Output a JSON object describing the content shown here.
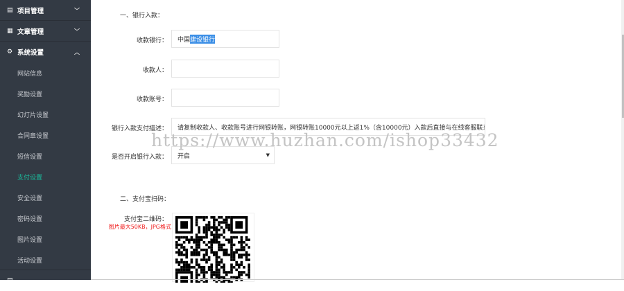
{
  "sidebar": {
    "groups": [
      {
        "label": "项目管理",
        "icon": "clipboard-icon",
        "chevron": "⌄"
      },
      {
        "label": "文章管理",
        "icon": "document-icon",
        "chevron": "⌄"
      },
      {
        "label": "系统设置",
        "icon": "gear-icon",
        "chevron": "⌃"
      }
    ],
    "sub_items": [
      "网站信息",
      "奖励设置",
      "幻灯片设置",
      "合同章设置",
      "短信设置",
      "支付设置",
      "安全设置",
      "密码设置",
      "图片设置",
      "活动设置"
    ],
    "active_index": 5,
    "active_color": "#1abc9c"
  },
  "form": {
    "section1": "一、银行入款：",
    "bank_label": "收款银行：",
    "bank_value_plain": "中国",
    "bank_value_selected": "建设银行",
    "payee_label": "收款人：",
    "payee_value": "",
    "account_label": "收款账号：",
    "account_value": "",
    "desc_label": "银行入款支付描述：",
    "desc_value": "请复制收款人、收款账号进行网银转账，网银转账10000元以上返1%（含10000元）入款后直接与在线客服联系",
    "enable_label": "是否开启银行入款：",
    "enable_value": "开启",
    "section2": "二、支付宝扫码：",
    "qr_label": "支付宝二维码：",
    "qr_hint": "图片最大50KB，JPG格式"
  },
  "watermark": "https://www.huzhan.com/ishop33432"
}
